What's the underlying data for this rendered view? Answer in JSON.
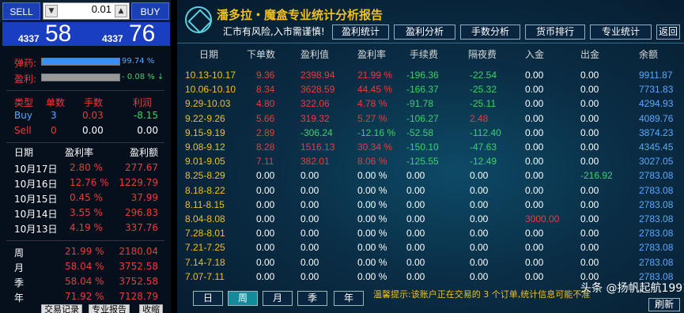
{
  "trade": {
    "sell_label": "SELL",
    "buy_label": "BUY",
    "lot": "0.01",
    "sell_small": "4337",
    "sell_big": "58",
    "buy_small": "4337",
    "buy_big": "76"
  },
  "meters": [
    {
      "label": "弹药:",
      "pct": "99.74 %",
      "fill": 0.9974,
      "color": "#3a8ff0",
      "pct_color": "#5aa8ff"
    },
    {
      "label": "盈利:",
      "pct": "- 0.08 % ↓",
      "fill": 1.0,
      "color": "#999999",
      "pct_color": "#3ad26a"
    }
  ],
  "positions": {
    "headers": [
      "类型",
      "单数",
      "手数",
      "利润"
    ],
    "rows": [
      {
        "type": "Buy",
        "count": "3",
        "lots": "0.03",
        "profit": "-8.15"
      },
      {
        "type": "Sell",
        "count": "0",
        "lots": "0.00",
        "profit": "0.00"
      }
    ]
  },
  "daily": {
    "headers": [
      "日期",
      "盈利率",
      "盈利额"
    ],
    "rows": [
      {
        "date": "10月17日",
        "rate": "2.80 %",
        "amount": "277.67"
      },
      {
        "date": "10月16日",
        "rate": "12.76 %",
        "amount": "1229.79"
      },
      {
        "date": "10月15日",
        "rate": "0.45 %",
        "amount": "37.99"
      },
      {
        "date": "10月14日",
        "rate": "3.55 %",
        "amount": "296.83"
      },
      {
        "date": "10月13日",
        "rate": "4.19 %",
        "amount": "337.76"
      }
    ]
  },
  "summary": {
    "rows": [
      {
        "period": "周",
        "rate": "21.99 %",
        "amount": "2180.04"
      },
      {
        "period": "月",
        "rate": "58.04 %",
        "amount": "3752.58"
      },
      {
        "period": "季",
        "rate": "58.04 %",
        "amount": "3752.58"
      },
      {
        "period": "年",
        "rate": "71.92 %",
        "amount": "7128.79"
      }
    ]
  },
  "footer_buttons": [
    "交易记录",
    "专业报告",
    "收缩"
  ],
  "report": {
    "title": "潘多拉・魔盒专业统计分析报告",
    "subtitle": "汇市有风险,入市需谨慎!",
    "tabs": [
      "盈利统计",
      "盈利分析",
      "手数分析",
      "货币排行",
      "专业统计",
      "返回"
    ],
    "columns": [
      "日期",
      "下单数",
      "盈利值",
      "盈利率",
      "手续费",
      "隔夜费",
      "入金",
      "出金",
      "余额"
    ],
    "rows": [
      [
        "10.13-10.17",
        "9.36",
        "2398.94",
        "21.99 %",
        "-196.36",
        "-22.54",
        "0.00",
        "0.00",
        "9911.87"
      ],
      [
        "10.06-10.10",
        "8.34",
        "3628.59",
        "44.45 %",
        "-166.37",
        "-25.32",
        "0.00",
        "0.00",
        "7731.83"
      ],
      [
        "9.29-10.03",
        "4.80",
        "322.06",
        "4.78 %",
        "-91.78",
        "-25.11",
        "0.00",
        "0.00",
        "4294.93"
      ],
      [
        "9.22-9.26",
        "5.66",
        "319.32",
        "5.27 %",
        "-106.27",
        "2.48",
        "0.00",
        "0.00",
        "4089.76"
      ],
      [
        "9.15-9.19",
        "2.89",
        "-306.24",
        "-12.16 %",
        "-52.58",
        "-112.40",
        "0.00",
        "0.00",
        "3874.23"
      ],
      [
        "9.08-9.12",
        "8.28",
        "1516.13",
        "30.34 %",
        "-150.10",
        "-47.63",
        "0.00",
        "0.00",
        "4345.45"
      ],
      [
        "9.01-9.05",
        "7.11",
        "382.01",
        "8.06 %",
        "-125.55",
        "-12.49",
        "0.00",
        "0.00",
        "3027.05"
      ],
      [
        "8.25-8.29",
        "0.00",
        "0.00",
        "0.00 %",
        "0.00",
        "0.00",
        "0.00",
        "-216.92",
        "2783.08"
      ],
      [
        "8.18-8.22",
        "0.00",
        "0.00",
        "0.00 %",
        "0.00",
        "0.00",
        "0.00",
        "0.00",
        "2783.08"
      ],
      [
        "8.11-8.15",
        "0.00",
        "0.00",
        "0.00 %",
        "0.00",
        "0.00",
        "0.00",
        "0.00",
        "2783.08"
      ],
      [
        "8.04-8.08",
        "0.00",
        "0.00",
        "0.00 %",
        "0.00",
        "0.00",
        "3000.00",
        "0.00",
        "2783.08"
      ],
      [
        "7.28-8.01",
        "0.00",
        "0.00",
        "0.00 %",
        "0.00",
        "0.00",
        "0.00",
        "0.00",
        "2783.08"
      ],
      [
        "7.21-7.25",
        "0.00",
        "0.00",
        "0.00 %",
        "0.00",
        "0.00",
        "0.00",
        "0.00",
        "2783.08"
      ],
      [
        "7.14-7.18",
        "0.00",
        "0.00",
        "0.00 %",
        "0.00",
        "0.00",
        "0.00",
        "0.00",
        "2783.08"
      ],
      [
        "7.07-7.11",
        "0.00",
        "0.00",
        "0.00 %",
        "0.00",
        "0.00",
        "0.00",
        "0.00",
        "2783.08"
      ]
    ],
    "period_buttons": [
      "日",
      "周",
      "月",
      "季",
      "年"
    ],
    "active_period": "周",
    "notice": "温馨提示:该账户正在交易的 3 个订单,统计信息可能不准",
    "refresh_label": "刷新",
    "watermark": "头条 @扬帆起航1991"
  },
  "colors": {
    "positive": "#ee3a3a",
    "negative": "#3ad26a",
    "neutral": "#ffffff",
    "balance": "#5aa8ff",
    "deposit": "#ee3a3a",
    "date": "#f0c020",
    "header": "#d8d8d8"
  }
}
